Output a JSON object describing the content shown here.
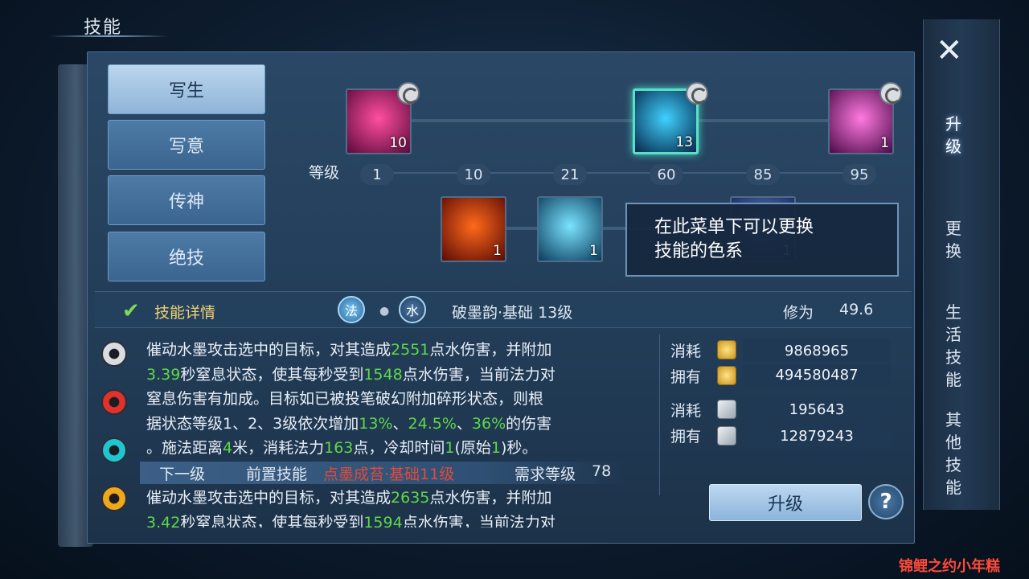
{
  "header": {
    "title": "技能"
  },
  "tabs": [
    {
      "label": "写生",
      "active": true
    },
    {
      "label": "写意",
      "active": false
    },
    {
      "label": "传神",
      "active": false
    },
    {
      "label": "绝技",
      "active": false
    }
  ],
  "tree": {
    "level_label": "等级",
    "level_markers": [
      "1",
      "10",
      "21",
      "60",
      "85",
      "95"
    ],
    "top_skills": [
      {
        "level": "10",
        "colors": [
          "#ff4fa0",
          "#5a0a3a"
        ]
      },
      {
        "level": "13",
        "colors": [
          "#3fd2ff",
          "#06284a"
        ],
        "selected": true
      },
      {
        "level": "1",
        "colors": [
          "#ff7ae0",
          "#4a0a48"
        ]
      }
    ],
    "bottom_skills": [
      {
        "level": "1",
        "colors": [
          "#ff6a1a",
          "#5a0a06"
        ]
      },
      {
        "level": "1",
        "colors": [
          "#7ae4ff",
          "#0a3a5a"
        ]
      },
      {
        "level": "1",
        "colors": [
          "#5a7ac8",
          "#1a2a5a"
        ]
      }
    ]
  },
  "tooltip": {
    "line1": "在此菜单下可以更换",
    "line2": "技能的色系"
  },
  "detail": {
    "label": "技能详情",
    "element1": "法",
    "element2": "水",
    "skill_name": "破墨韵·基础 13级",
    "xiuwei_label": "修为",
    "xiuwei_value": "49.6"
  },
  "color_dots": [
    "#d9dde2",
    "#e0312a",
    "#1fc6d2",
    "#f0a81a"
  ],
  "description": {
    "l1": [
      "催动水墨攻击选中的目标，对其造成",
      "2551",
      "点水伤害，并附加"
    ],
    "l2": [
      "3.39",
      "秒窒息状态，使其每秒受到",
      "1548",
      "点水伤害，当前法力对"
    ],
    "l3": "窒息伤害有加成。目标如已被投笔破幻附加碎形状态，则根",
    "l4": [
      "据状态等级1、2、3级依次增加",
      "13%",
      "、",
      "24.5%",
      "、",
      "36%",
      "的伤害"
    ],
    "l5": [
      "。施法距离",
      "4",
      "米，消耗法力",
      "163",
      "点，冷却时间",
      "1",
      "(原始",
      "1",
      ")秒。"
    ]
  },
  "next_level": {
    "label": "下一级",
    "prereq_label": "前置技能",
    "prereq_value": "点墨成苔·基础11级",
    "req_label": "需求等级",
    "req_value": "78"
  },
  "next_description": {
    "l1": [
      "催动水墨攻击选中的目标，对其造成",
      "2635",
      "点水伤害，并附加"
    ],
    "l2": [
      "3.42",
      "秒窒息状态，使其每秒受到",
      "1594",
      "点水伤害，当前法力对"
    ]
  },
  "resources": [
    {
      "label": "消耗",
      "icon": "coin-icon",
      "value": "9868965"
    },
    {
      "label": "拥有",
      "icon": "coin-icon",
      "value": "494580487"
    },
    {
      "label": "消耗",
      "icon": "paper-icon",
      "value": "195643"
    },
    {
      "label": "拥有",
      "icon": "paper-icon",
      "value": "12879243"
    }
  ],
  "buttons": {
    "upgrade": "升级",
    "help": "?",
    "close": "✕"
  },
  "side_tabs": [
    {
      "label": "升级",
      "active": true
    },
    {
      "label": "更换",
      "active": false
    },
    {
      "label": "生活技能",
      "active": false
    },
    {
      "label": "其他技能",
      "active": false
    }
  ],
  "watermark": "锦鲤之约小年糕"
}
